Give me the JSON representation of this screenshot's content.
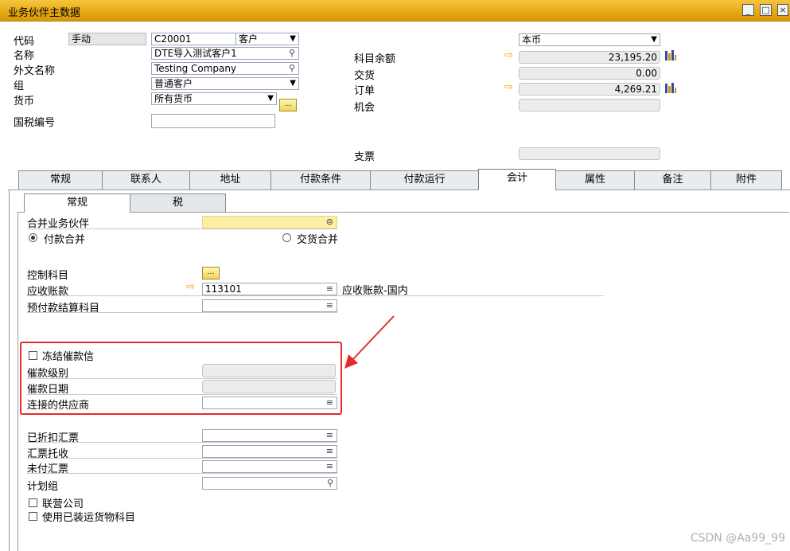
{
  "window": {
    "title": "业务伙伴主数据",
    "controls": [
      "_",
      "□",
      "×"
    ]
  },
  "header": {
    "code_label": "代码",
    "code_mode": "手动",
    "code_value": "C20001",
    "type_value": "客户",
    "name_label": "名称",
    "name_value": "DTE导入测试客户1",
    "foreign_name_label": "外文名称",
    "foreign_name_value": "Testing Company",
    "group_label": "组",
    "group_value": "普通客户",
    "currency_label": "货币",
    "currency_value": "所有货币",
    "currency_btn": "...",
    "tax_id_label": "国税编号",
    "tax_id_value": "",
    "currency_type_value": "本币",
    "balance_label": "科目余额",
    "balance_value": "23,195.20",
    "delivery_label": "交货",
    "delivery_value": "0.00",
    "order_label": "订单",
    "order_value": "4,269.21",
    "opportunity_label": "机会",
    "opportunity_value": "",
    "check_label": "支票",
    "check_value": ""
  },
  "tabs": [
    "常规",
    "联系人",
    "地址",
    "付款条件",
    "付款运行",
    "会计",
    "属性",
    "备注",
    "附件"
  ],
  "active_tab": "会计",
  "subtabs": [
    "常规",
    "税"
  ],
  "active_subtab": "常规",
  "accounting": {
    "consolidate_bp_label": "合并业务伙伴",
    "consolidate_bp_value": "",
    "payment_consolidation_label": "付款合并",
    "delivery_consolidation_label": "交货合并",
    "control_account_label": "控制科目",
    "control_btn": "...",
    "ar_label": "应收账款",
    "ar_value": "113101",
    "ar_desc": "应收账款-国内",
    "down_payment_label": "预付款结算科目",
    "down_payment_value": "",
    "block_dunning_label": "冻结催款信",
    "dunning_level_label": "催款级别",
    "dunning_date_label": "催款日期",
    "connected_vendor_label": "连接的供应商",
    "connected_vendor_value": "",
    "discounted_bills_label": "已折扣汇票",
    "bills_collection_label": "汇票托收",
    "unpaid_bills_label": "未付汇票",
    "planning_group_label": "计划组",
    "affiliate_label": "联营公司",
    "use_shipped_goods_label": "使用已装运货物科目"
  },
  "watermark": "CSDN @Aa99_99",
  "colors": {
    "titlebar": "#e7a712",
    "highlight_box": "#e8292b",
    "arrow": "#e7a800",
    "yellow_field": "#fbefa6"
  }
}
